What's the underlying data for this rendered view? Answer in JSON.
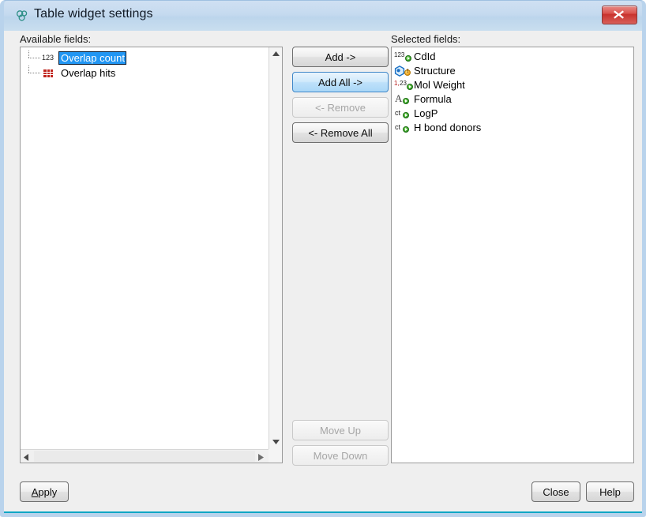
{
  "window": {
    "title": "Table widget settings",
    "title_icon": "molecule-icon",
    "close_label": "close-icon",
    "accent_color": "#b9d3ec",
    "titlebar_color": "#c5daef",
    "body_color": "#efefef"
  },
  "available": {
    "label": "Available fields:",
    "items": [
      {
        "label": "Overlap count",
        "icon": "number-123-icon",
        "selected": true
      },
      {
        "label": "Overlap hits",
        "icon": "red-grid-icon",
        "selected": false
      }
    ],
    "scroll": {
      "up_arrow": "scroll-up-arrow-icon",
      "down_arrow": "scroll-down-arrow-icon",
      "left_arrow": "scroll-left-arrow-icon",
      "right_arrow": "scroll-right-arrow-icon"
    }
  },
  "selected": {
    "label": "Selected fields:",
    "items": [
      {
        "label": "CdId",
        "icon": "int-field-icon",
        "glyph": "123",
        "badge": "green"
      },
      {
        "label": "Structure",
        "icon": "structure-field-icon",
        "glyph": "",
        "badge": "orange"
      },
      {
        "label": "Mol Weight",
        "icon": "decimal-field-icon",
        "glyph": "1,23",
        "badge": "green"
      },
      {
        "label": "Formula",
        "icon": "text-field-icon",
        "glyph": "A",
        "badge": "green"
      },
      {
        "label": "LogP",
        "icon": "calc-field-icon",
        "glyph": "ct",
        "badge": "green"
      },
      {
        "label": "H bond donors",
        "icon": "calc-field-icon",
        "glyph": "ct",
        "badge": "green"
      }
    ]
  },
  "transfer_buttons": {
    "add": "Add ->",
    "add_all": "Add All ->",
    "remove": "<- Remove",
    "remove_all": "<- Remove All"
  },
  "order_buttons": {
    "move_up": "Move Up",
    "move_down": "Move Down"
  },
  "footer": {
    "apply_mnemonic": "A",
    "apply_rest": "pply",
    "close": "Close",
    "help": "Help"
  }
}
